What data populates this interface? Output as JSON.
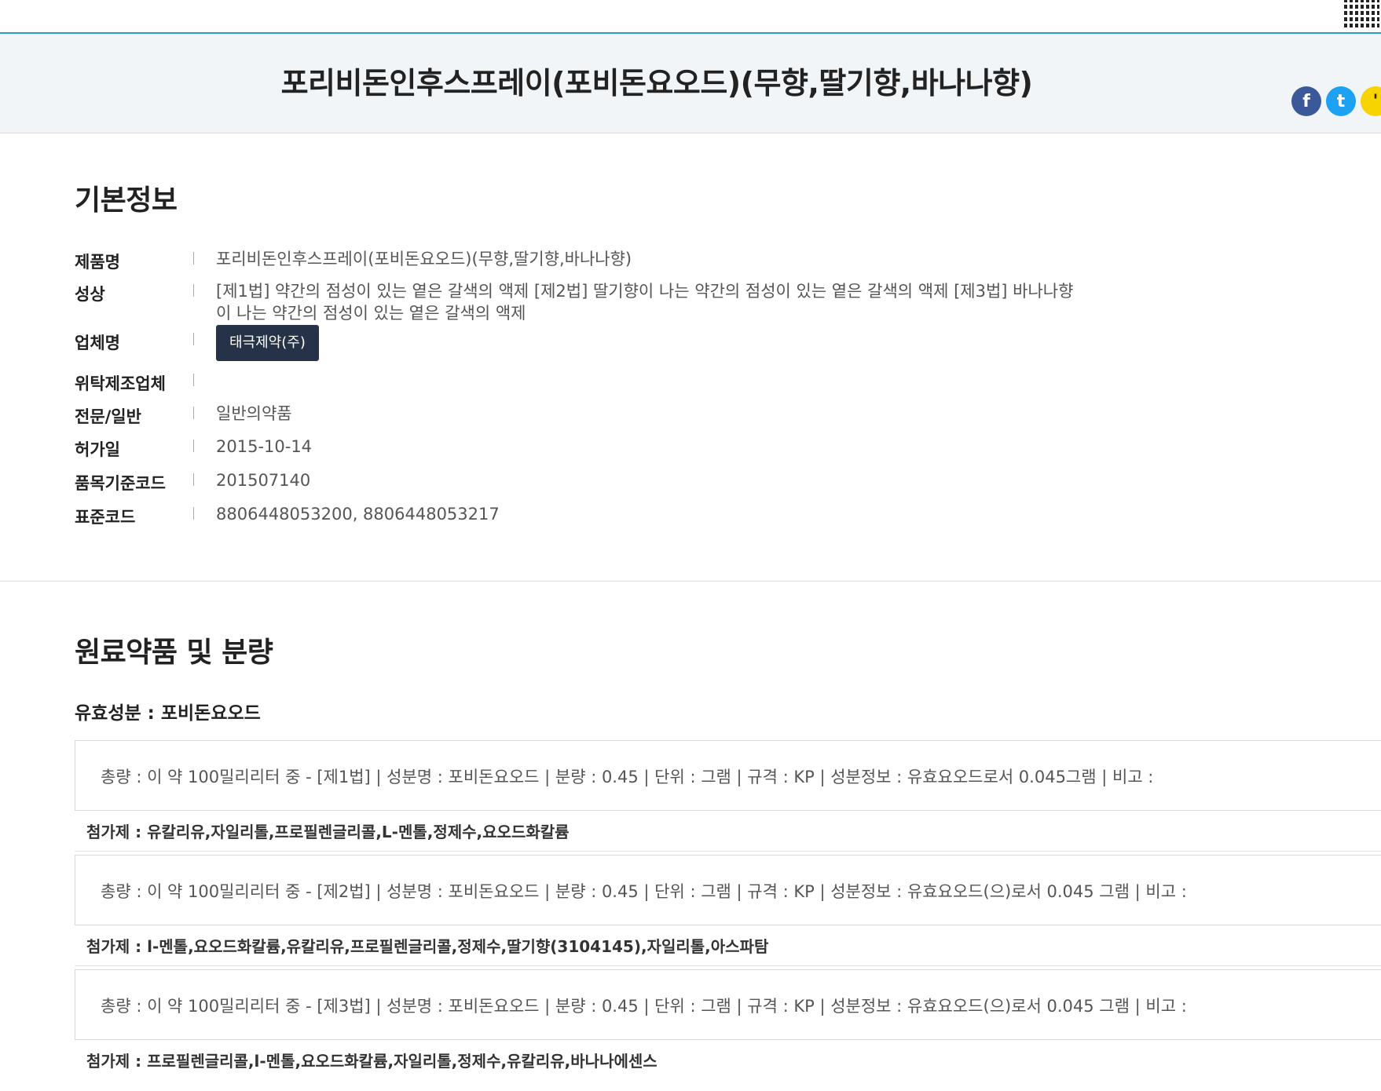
{
  "header": {
    "title": "포리비돈인후스프레이(포비돈요오드)(무향,딸기향,바나나향)"
  },
  "share": [
    {
      "icon": "facebook-icon",
      "glyph": "f"
    },
    {
      "icon": "twitter-icon",
      "glyph": "t"
    },
    {
      "icon": "kakao-icon",
      "glyph": "'"
    }
  ],
  "basic_info": {
    "heading": "기본정보",
    "product_name": {
      "label": "제품명",
      "value": "포리비돈인후스프레이(포비돈요오드)(무향,딸기향,바나나향)"
    },
    "appearance": {
      "label": "성상",
      "value_line1": "[제1법] 약간의 점성이 있는 옅은 갈색의 액제 [제2법] 딸기향이 나는 약간의 점성이 있는 옅은 갈색의 액제 [제3법] 바나나향",
      "value_line2": "이 나는 약간의 점성이 있는 옅은 갈색의 액제"
    },
    "company": {
      "label": "업체명",
      "button": "태극제약(주)"
    },
    "contract_maker": {
      "label": "위탁제조업체",
      "value": ""
    },
    "category": {
      "label": "전문/일반",
      "value": "일반의약품"
    },
    "permit_date": {
      "label": "허가일",
      "value": "2015-10-14"
    },
    "item_code": {
      "label": "품목기준코드",
      "value": "201507140"
    },
    "standard_code": {
      "label": "표준코드",
      "value": "8806448053200, 8806448053217"
    }
  },
  "ingredients": {
    "heading": "원료약품 및 분량",
    "active": "유효성분 : 포비돈요오드",
    "items": [
      {
        "detail": "총량 : 이 약 100밀리리터 중 - [제1법]  |  성분명 : 포비돈요오드  |  분량 : 0.45  |  단위 : 그램  |  규격 : KP  |  성분정보 : 유효요오드로서 0.045그램  |  비고 :",
        "additive": "첨가제 : 유칼리유,자일리톨,프로필렌글리콜,L-멘톨,정제수,요오드화칼륨"
      },
      {
        "detail": "총량 : 이 약 100밀리리터 중 - [제2법]  |  성분명 : 포비돈요오드  |  분량 : 0.45  |  단위 : 그램  |  규격 : KP  |  성분정보 : 유효요오드(으)로서 0.045 그램  |  비고 :",
        "additive": "첨가제 : l-멘톨,요오드화칼륨,유칼리유,프로필렌글리콜,정제수,딸기향(3104145),자일리톨,아스파탐"
      },
      {
        "detail": "총량 : 이 약 100밀리리터 중 - [제3법]  |  성분명 : 포비돈요오드  |  분량 : 0.45  |  단위 : 그램  |  규격 : KP  |  성분정보 : 유효요오드(으)로서 0.045 그램  |  비고 :",
        "additive": "첨가제 : 프로필렌글리콜,l-멘톨,요오드화칼륨,자일리톨,정제수,유칼리유,바나나에센스"
      }
    ]
  },
  "colors": {
    "accent_line": "#2aa3c3",
    "company_button": "#253247"
  }
}
